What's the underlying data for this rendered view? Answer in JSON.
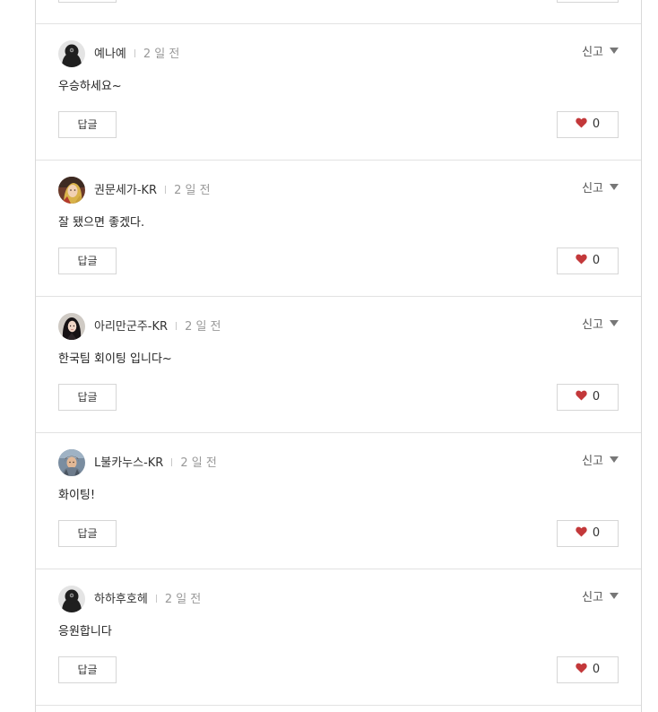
{
  "colors": {
    "heart": "#c3383a",
    "border": "#d6d6d6",
    "time_text": "#999999"
  },
  "comments": [
    {
      "author": "예나예",
      "time": "2 일 전",
      "text": "우승하세요~",
      "avatar_icon": "default-silhouette-avatar",
      "report_label": "신고",
      "reply_label": "답글",
      "likes": "0"
    },
    {
      "author": "권문세가-KR",
      "time": "2 일 전",
      "text": "잘 됐으면 좋겠다.",
      "avatar_icon": "character-portrait-blonde-avatar",
      "report_label": "신고",
      "reply_label": "답글",
      "likes": "0"
    },
    {
      "author": "아리만군주-KR",
      "time": "2 일 전",
      "text": "한국팀 회이팅 입니다~",
      "avatar_icon": "character-portrait-darkhair-avatar",
      "report_label": "신고",
      "reply_label": "답글",
      "likes": "0"
    },
    {
      "author": "L불카누스-KR",
      "time": "2 일 전",
      "text": "화이팅!",
      "avatar_icon": "character-portrait-armored-avatar",
      "report_label": "신고",
      "reply_label": "답글",
      "likes": "0"
    },
    {
      "author": "하하후호헤",
      "time": "2 일 전",
      "text": "응원합니다",
      "avatar_icon": "default-silhouette-avatar",
      "report_label": "신고",
      "reply_label": "답글",
      "likes": "0"
    }
  ]
}
